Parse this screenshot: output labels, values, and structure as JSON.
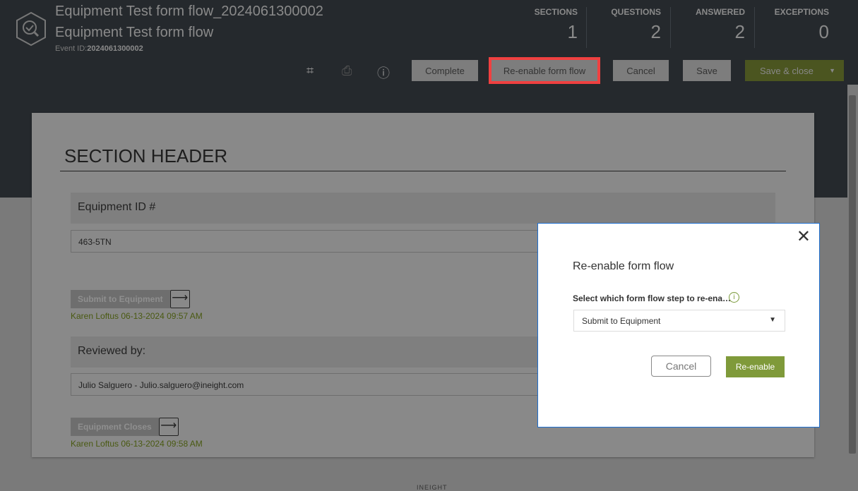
{
  "header": {
    "title": "Equipment Test form flow_2024061300002",
    "subtitle": "Equipment Test form flow",
    "event_label": "Event ID:",
    "event_id": "2024061300002"
  },
  "stats": [
    {
      "label": "SECTIONS",
      "value": "1"
    },
    {
      "label": "QUESTIONS",
      "value": "2"
    },
    {
      "label": "ANSWERED",
      "value": "2"
    },
    {
      "label": "EXCEPTIONS",
      "value": "0"
    }
  ],
  "toolbar": {
    "complete": "Complete",
    "reenable": "Re-enable form flow",
    "cancel": "Cancel",
    "save": "Save",
    "save_close": "Save & close"
  },
  "form": {
    "section_header": "SECTION HEADER",
    "q1": {
      "label": "Equipment ID #",
      "value": "463-5TN",
      "flow_button": "Submit to Equipment",
      "signed": "Karen Loftus 06-13-2024 09:57 AM"
    },
    "q2": {
      "label": "Reviewed by:",
      "value": "Julio Salguero - Julio.salguero@ineight.com",
      "flow_button": "Equipment Closes",
      "signed": "Karen Loftus 06-13-2024 09:58 AM"
    }
  },
  "footer": {
    "logo": "INEIGHT"
  },
  "modal": {
    "title": "Re-enable form flow",
    "field_label": "Select which form flow step to re-ena…",
    "selected": "Submit to Equipment",
    "cancel": "Cancel",
    "confirm": "Re-enable"
  }
}
